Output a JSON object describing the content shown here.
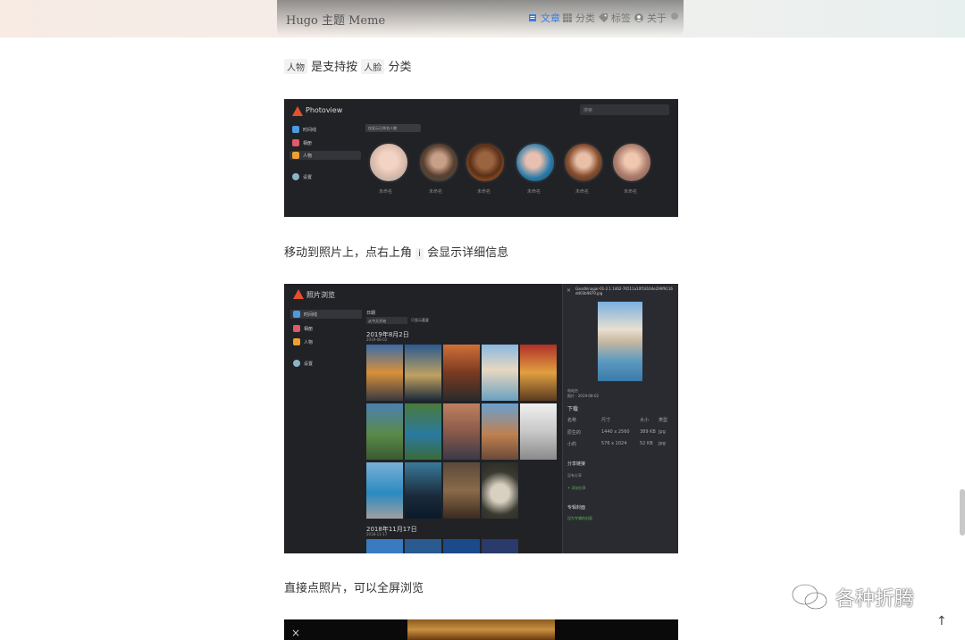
{
  "header": {
    "site_title": "Hugo 主题 Meme",
    "nav": [
      {
        "label": "文章",
        "icon": "article-icon"
      },
      {
        "label": "分类",
        "icon": "grid-icon"
      },
      {
        "label": "标签",
        "icon": "tag-icon"
      },
      {
        "label": "关于",
        "icon": "user-icon"
      }
    ]
  },
  "article": {
    "para1_tag1": "人物",
    "para1_text1": "是支持按",
    "para1_tag2": "人脸",
    "para1_text2": "分类",
    "para2": "移动到照片上，点右上角",
    "para2_tag": "i",
    "para2_end": "会显示详细信息",
    "para3": "直接点照片，可以全屏浏览"
  },
  "shot1": {
    "app_name": "Photoview",
    "search_placeholder": "搜索",
    "sidebar": [
      "时间线",
      "相册",
      "人物",
      "设置"
    ],
    "banner": "仅显示已命名人物",
    "face_label": "未命名"
  },
  "shot2": {
    "app_name": "照片浏览",
    "sidebar": [
      "时间线",
      "相册",
      "人物",
      "设置"
    ],
    "filter_label": "日期",
    "filter_select": "从今天开始",
    "favorites_label": "只显示喜爱",
    "date1": "2019年8月2日",
    "date1_sub": "2019-08-02",
    "date2": "2018年11月17日",
    "date2_sub": "2018-11-17",
    "detail": {
      "filename": "Gandhinagar-01-2.1.1462-76511a10f18164e299f9116dd03b9870.jpg",
      "date_label": "电站台",
      "date_value": "照片 · 2019-08-02",
      "download_title": "下载",
      "table_headers": [
        "名称",
        "尺寸",
        "大小",
        "类型"
      ],
      "rows": [
        {
          "name": "原生的",
          "size": "1440 x 2560",
          "bytes": "389 KB",
          "type": "jpg"
        },
        {
          "name": "小的",
          "size": "576 x 1024",
          "bytes": "52 KB",
          "type": "jpg"
        }
      ],
      "share_title": "分享链接",
      "share_none": "没有分享",
      "share_add": "+ 添加分享",
      "album_title": "专辑封面",
      "album_action": "设为专辑的封面"
    }
  },
  "watermark": {
    "text": "各种折腾"
  },
  "colors": {
    "accent": "#3a7be0",
    "app_bg": "#212226",
    "logo": "#e5502a"
  }
}
